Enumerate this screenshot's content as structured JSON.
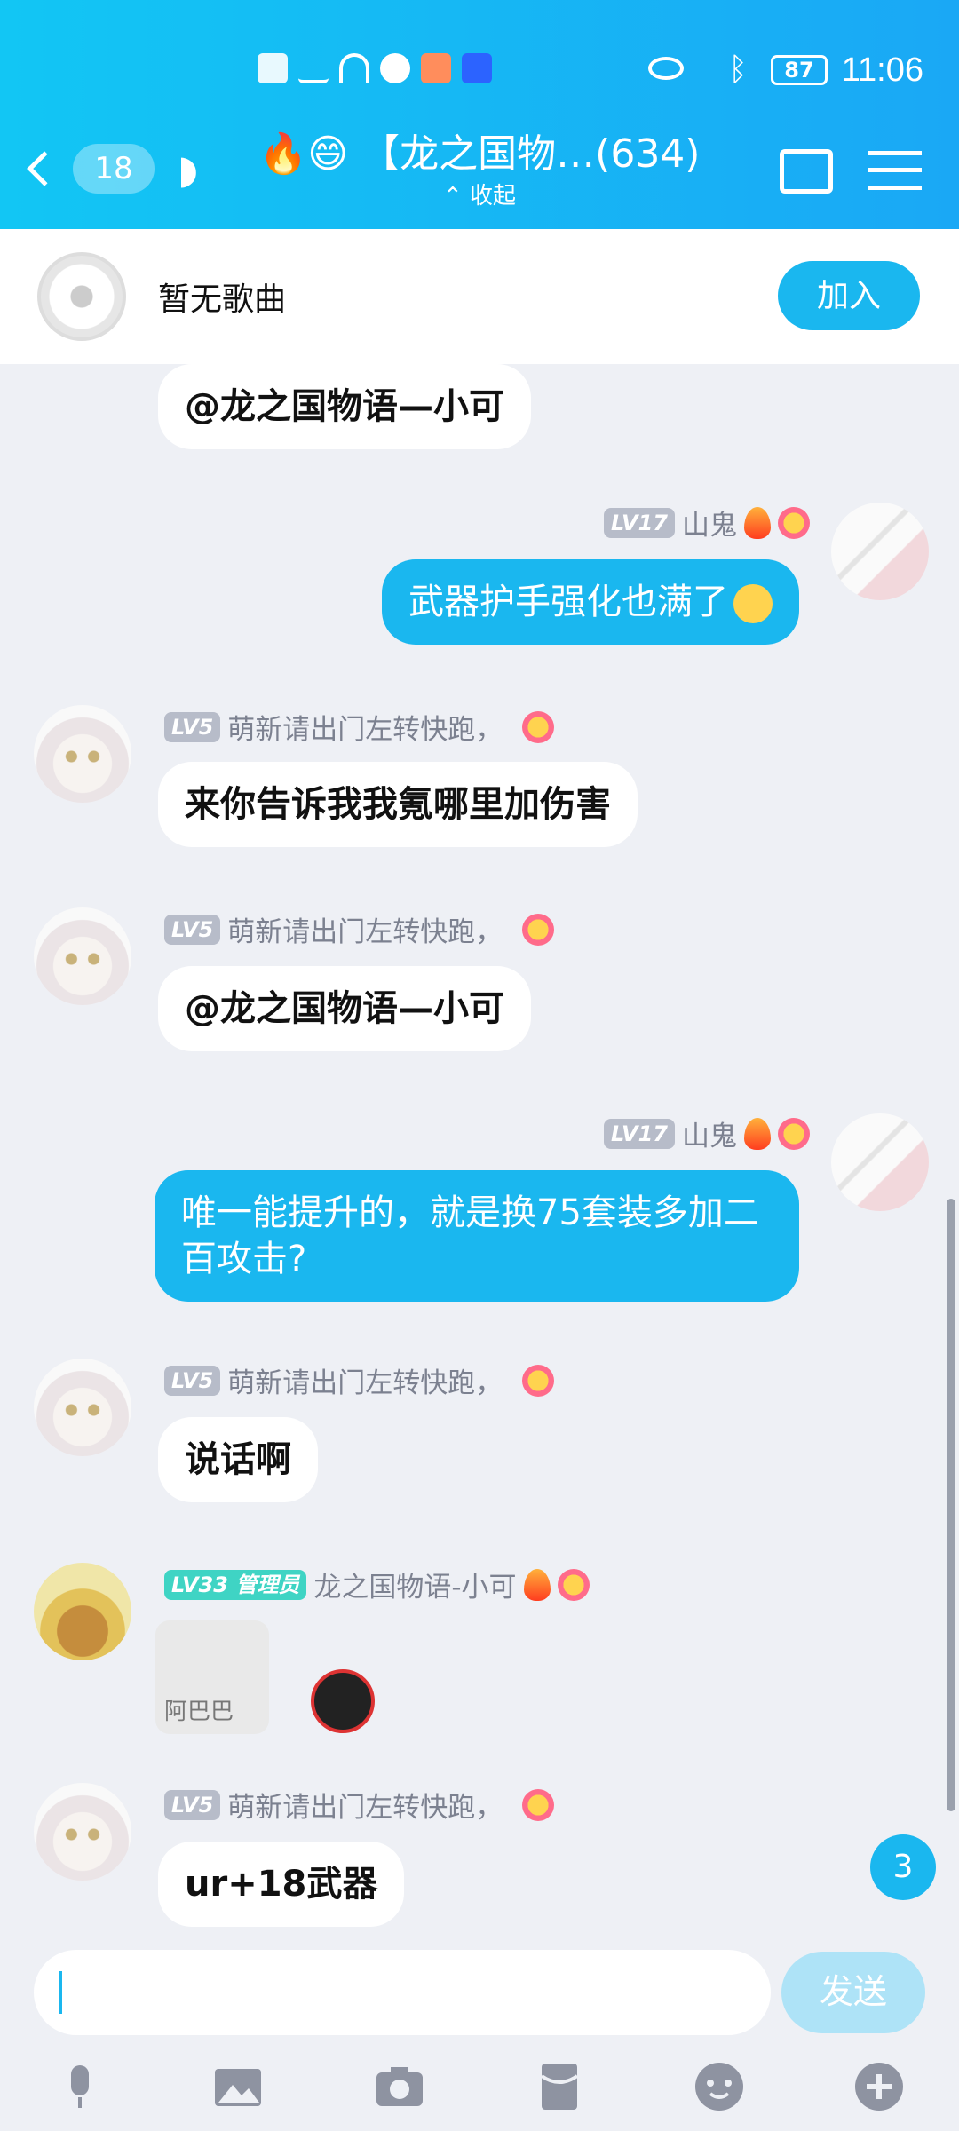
{
  "status_bar": {
    "time": "11:06",
    "battery": "87"
  },
  "header": {
    "back_count": "18",
    "title": "🔥😄 【龙之国物…(634)",
    "subtitle": "收起"
  },
  "music": {
    "label": "暂无歌曲",
    "join_label": "加入"
  },
  "messages": [
    {
      "text": "@龙之国物语—小可"
    },
    {
      "level": "LV17",
      "sender": "山鬼",
      "text": "武器护手强化也满了"
    },
    {
      "level": "LV5",
      "sender": "萌新请出门左转快跑，",
      "text": "来你告诉我我氪哪里加伤害"
    },
    {
      "level": "LV5",
      "sender": "萌新请出门左转快跑，",
      "text": "@龙之国物语—小可"
    },
    {
      "level": "LV17",
      "sender": "山鬼",
      "text": "唯一能提升的，就是换75套装多加二百攻击?"
    },
    {
      "level": "LV5",
      "sender": "萌新请出门左转快跑，",
      "text": "说话啊"
    },
    {
      "level": "LV33",
      "role": "管理员",
      "sender": "龙之国物语-小可",
      "sticker_text": "阿巴巴"
    },
    {
      "level": "LV5",
      "sender": "萌新请出门左转快跑，",
      "text": "ur+18武器"
    }
  ],
  "unread_count": "3",
  "input": {
    "placeholder": "",
    "send_label": "发送"
  },
  "toolbar": [
    "mic-icon",
    "image-icon",
    "camera-icon",
    "redpacket-icon",
    "emoji-icon",
    "plus-icon"
  ]
}
